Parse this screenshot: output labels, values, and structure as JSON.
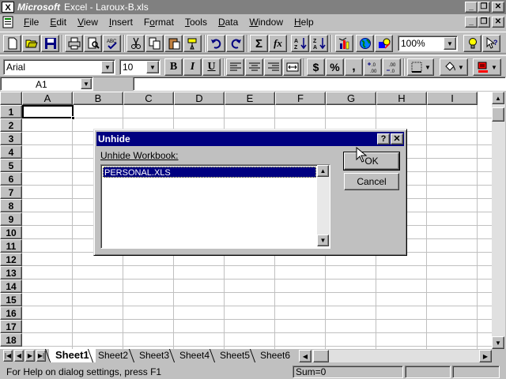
{
  "window": {
    "app_name": "Microsoft",
    "title": "Excel - Laroux-B.xls",
    "minimize": "_",
    "restore": "❐",
    "close": "✕"
  },
  "menu": [
    "File",
    "Edit",
    "View",
    "Insert",
    "Format",
    "Tools",
    "Data",
    "Window",
    "Help"
  ],
  "menu_accel": [
    "F",
    "E",
    "V",
    "I",
    "o",
    "T",
    "D",
    "W",
    "H"
  ],
  "toolbar": {
    "zoom": "100%",
    "sum_label": "Σ",
    "fx_label": "fx"
  },
  "format_bar": {
    "font": "Arial",
    "size": "10",
    "bold": "B",
    "italic": "I",
    "underline": "U",
    "currency": "$",
    "percent": "%",
    "comma": ","
  },
  "formula_bar": {
    "name_box": "A1",
    "value": ""
  },
  "grid": {
    "columns": [
      "A",
      "B",
      "C",
      "D",
      "E",
      "F",
      "G",
      "H",
      "I"
    ],
    "rows": [
      "1",
      "2",
      "3",
      "4",
      "5",
      "6",
      "7",
      "8",
      "9",
      "10",
      "11",
      "12",
      "13",
      "14",
      "15",
      "16",
      "17",
      "18"
    ]
  },
  "sheets": [
    "Sheet1",
    "Sheet2",
    "Sheet3",
    "Sheet4",
    "Sheet5",
    "Sheet6"
  ],
  "active_sheet": "Sheet1",
  "status": {
    "message": "For Help on dialog settings, press F1",
    "sum": "Sum=0"
  },
  "dialog": {
    "title": "Unhide",
    "help_glyph": "?",
    "close_glyph": "✕",
    "label": "Unhide Workbook:",
    "items": [
      "PERSONAL.XLS"
    ],
    "ok": "OK",
    "cancel": "Cancel"
  }
}
